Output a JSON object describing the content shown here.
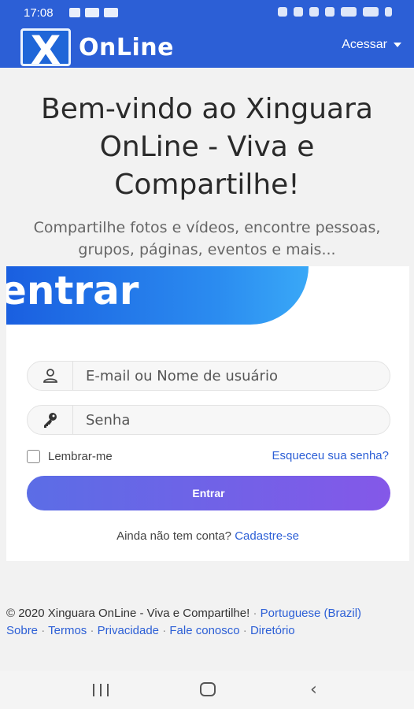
{
  "status_bar": {
    "time": "17:08"
  },
  "header": {
    "logo_glyph": "X",
    "logo_text": "OnLine",
    "menu_label": "Acessar"
  },
  "hero": {
    "title_line1": "Bem-vindo ao Xinguara",
    "title_line2": "OnLine - Viva e",
    "title_line3": "Compartilhe!",
    "subtitle_line1": "Compartilhe fotos e vídeos, encontre pessoas,",
    "subtitle_line2": "grupos, páginas, eventos e mais..."
  },
  "login": {
    "banner_title": "entrar",
    "username_placeholder": "E-mail ou Nome de usuário",
    "password_placeholder": "Senha",
    "remember_label": "Lembrar-me",
    "forgot_link": "Esqueceu sua senha?",
    "submit_label": "Entrar",
    "signup_prompt": "Ainda não tem conta?",
    "signup_link": "Cadastre-se"
  },
  "footer": {
    "copyright": "© 2020 Xinguara OnLine - Viva e Compartilhe!",
    "language": "Portuguese (Brazil)",
    "links": [
      "Sobre",
      "Termos",
      "Privacidade",
      "Fale conosco",
      "Diretório"
    ]
  },
  "colors": {
    "brand_blue": "#2c5fd6",
    "button_gradient_start": "#5b6de6",
    "button_gradient_end": "#8458e8"
  },
  "icons": {
    "user_field": "user-icon",
    "password_field": "key-icon"
  }
}
